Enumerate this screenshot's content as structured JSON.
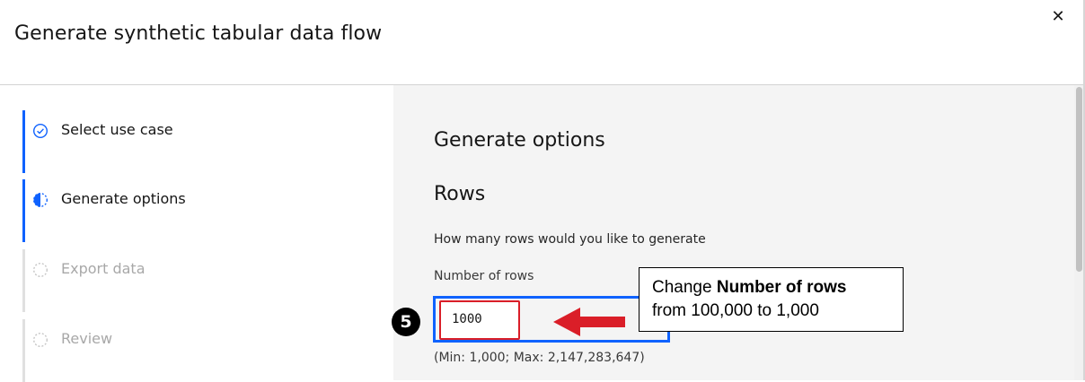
{
  "window": {
    "title": "Generate synthetic tabular data flow",
    "close_symbol": "✕"
  },
  "steps": [
    {
      "label": "Select use case",
      "state": "complete",
      "icon": "checkmark-circle-icon"
    },
    {
      "label": "Generate options",
      "state": "current",
      "icon": "half-filled-circle-icon"
    },
    {
      "label": "Export data",
      "state": "incomplete",
      "icon": "dashed-circle-icon"
    },
    {
      "label": "Review",
      "state": "incomplete",
      "icon": "dashed-circle-icon"
    }
  ],
  "main": {
    "section_title": "Generate options",
    "rows_title": "Rows",
    "helper_text": "How many rows would you like to generate",
    "field_label": "Number of rows",
    "field_value": "1000",
    "range_text": "(Min: 1,000; Max: 2,147,283,647)"
  },
  "annotation": {
    "step_number": "5",
    "callout_prefix": "Change ",
    "callout_bold": "Number of rows",
    "callout_line2": "from 100,000 to 1,000"
  },
  "colors": {
    "accent": "#0f62fe",
    "highlight": "#da1e28",
    "panel_bg": "#f4f4f4"
  }
}
